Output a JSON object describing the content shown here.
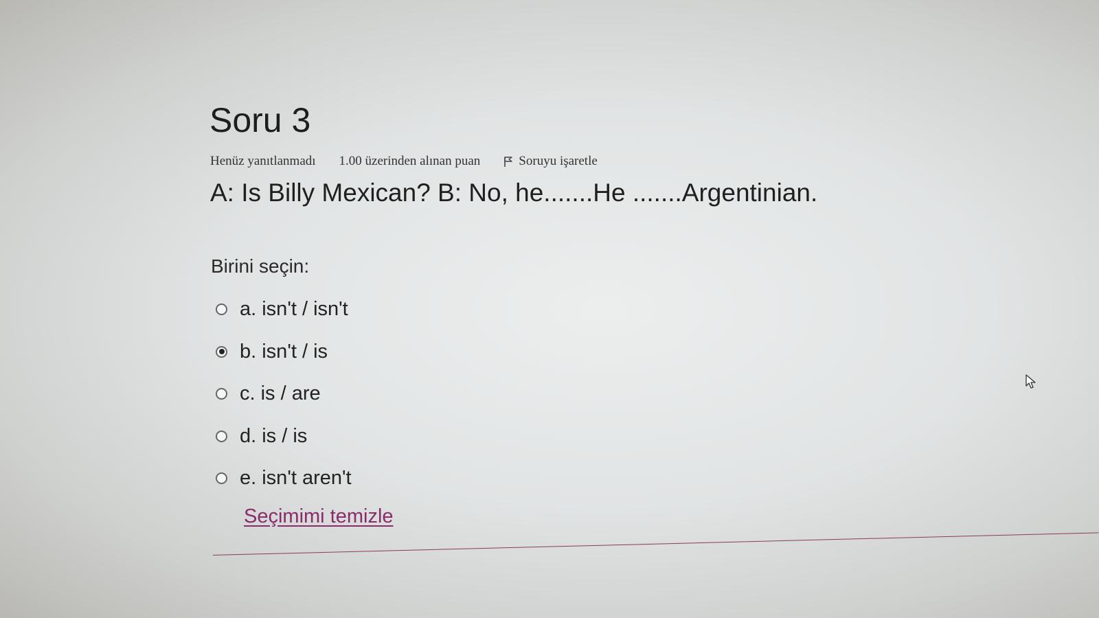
{
  "question": {
    "title": "Soru 3",
    "status": "Henüz yanıtlanmadı",
    "points": "1.00 üzerinden alınan puan",
    "flag_label": "Soruyu işaretle",
    "text": "A: Is Billy Mexican? B: No, he.......He .......Argentinian."
  },
  "answer": {
    "prompt": "Birini seçin:",
    "options": [
      {
        "label": "a. isn't / isn't",
        "selected": false
      },
      {
        "label": "b. isn't / is",
        "selected": true
      },
      {
        "label": "c. is / are",
        "selected": false
      },
      {
        "label": "d. is / is",
        "selected": false
      },
      {
        "label": "e. isn't aren't",
        "selected": false
      }
    ],
    "clear_label": "Seçimimi temizle"
  },
  "icons": {
    "flag": "flag-icon",
    "cursor": "mouse-pointer-icon"
  },
  "colors": {
    "link": "#8a2b6c",
    "divider": "#8a3a5a"
  }
}
